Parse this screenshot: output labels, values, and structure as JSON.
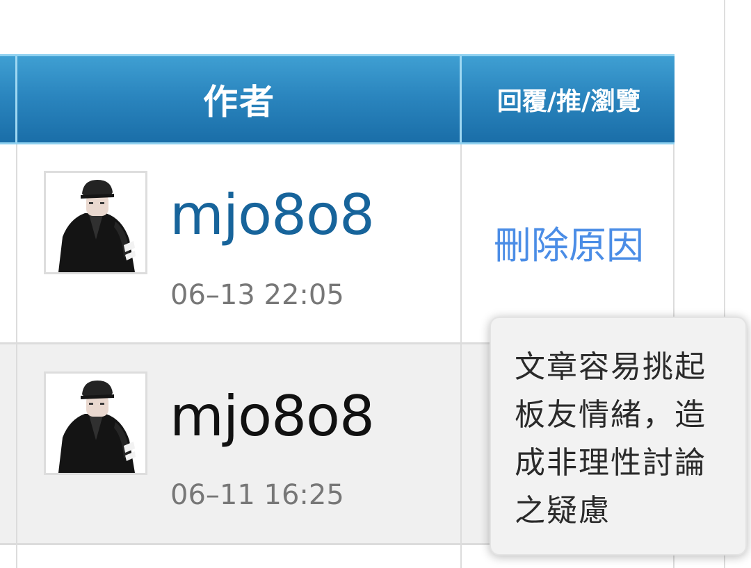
{
  "header": {
    "author_label": "作者",
    "stats_label": "回覆/推/瀏覽"
  },
  "posts": [
    {
      "author": "mjo8o8",
      "time": "06–13 22:05",
      "status": "刪除原因"
    },
    {
      "author": "mjo8o8",
      "time": "06–11 16:25"
    }
  ],
  "tooltip": {
    "text": "文章容易挑起板友情緒，造成非理性討論之疑慮"
  },
  "colors": {
    "header_blue": "#2b86bf",
    "link_blue": "#17649b",
    "reason_blue": "#4b8de6"
  }
}
